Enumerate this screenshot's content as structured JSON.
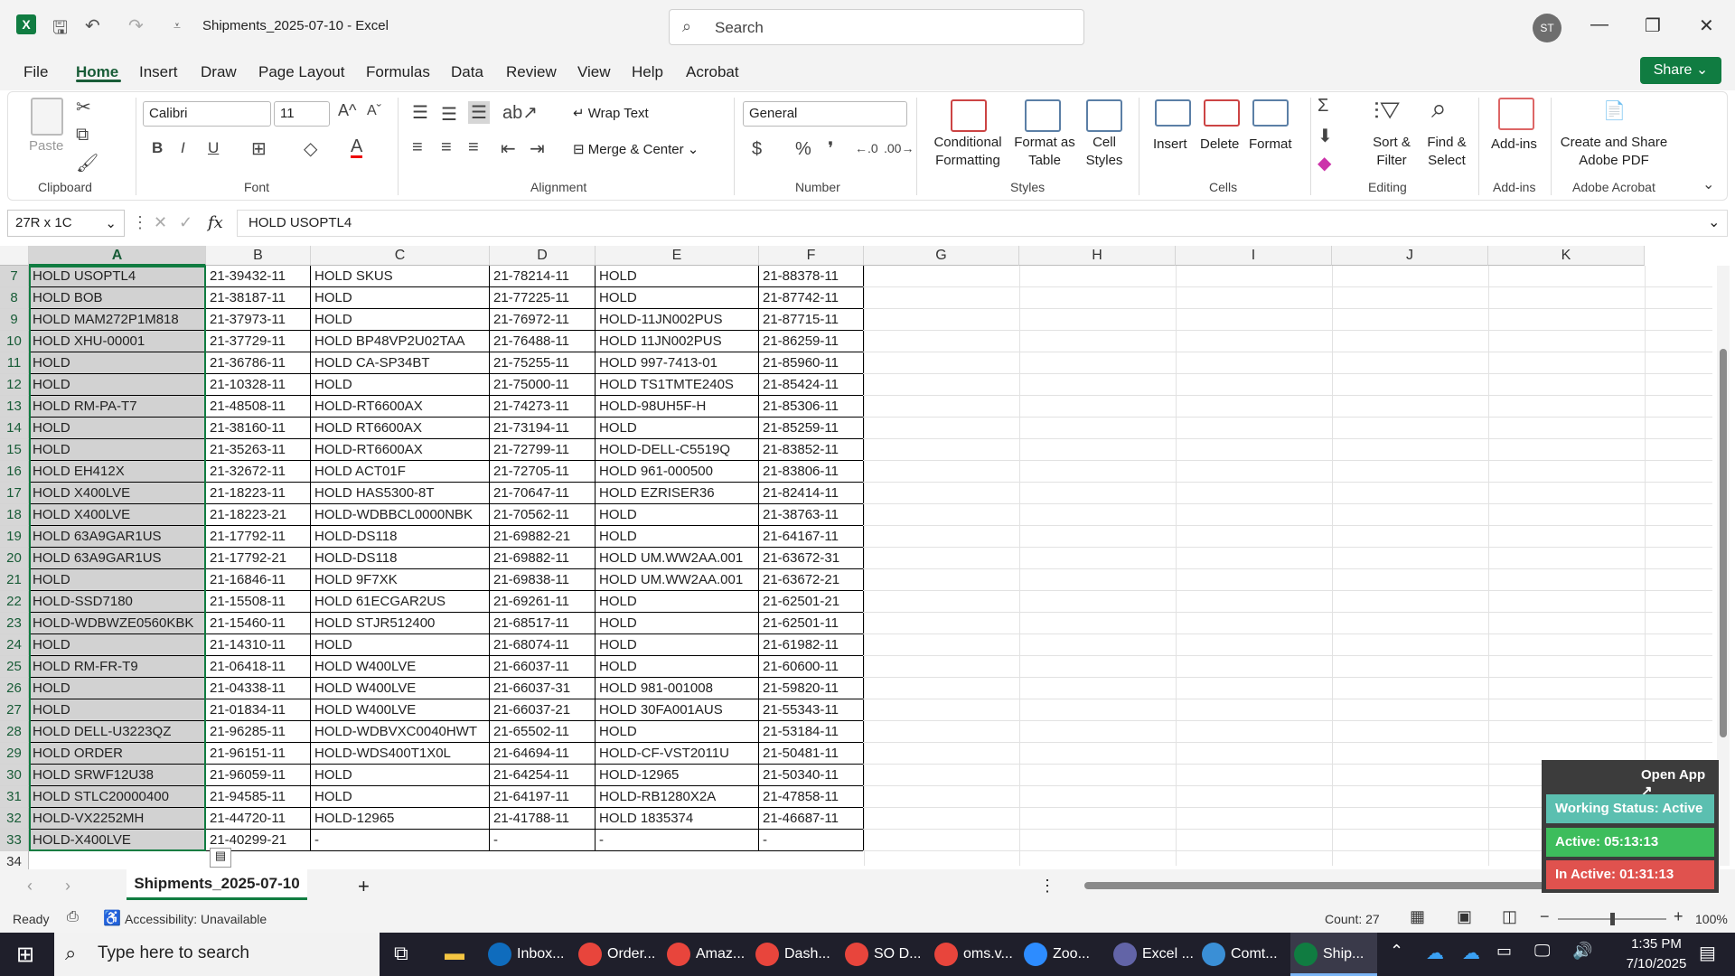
{
  "window": {
    "title": "Shipments_2025-07-10 - Excel",
    "search_placeholder": "Search",
    "user_initials": "ST"
  },
  "tabs": [
    "File",
    "Home",
    "Insert",
    "Draw",
    "Page Layout",
    "Formulas",
    "Data",
    "Review",
    "View",
    "Help",
    "Acrobat"
  ],
  "share_label": "Share",
  "ribbon": {
    "clipboard": {
      "paste": "Paste",
      "label": "Clipboard"
    },
    "font": {
      "name": "Calibri",
      "size": "11",
      "label": "Font"
    },
    "alignment": {
      "wrap": "Wrap Text",
      "merge": "Merge & Center",
      "label": "Alignment"
    },
    "number": {
      "format": "General",
      "label": "Number"
    },
    "styles": {
      "conditional": "Conditional Formatting",
      "format_table": "Format as Table",
      "cell_styles": "Cell Styles",
      "label": "Styles"
    },
    "cells": {
      "insert": "Insert",
      "delete": "Delete",
      "format": "Format",
      "label": "Cells"
    },
    "editing": {
      "sort": "Sort & Filter",
      "find": "Find & Select",
      "label": "Editing"
    },
    "addins": {
      "button": "Add-ins",
      "label": "Add-ins"
    },
    "acrobat": {
      "button": "Create and Share Adobe PDF",
      "label": "Adobe Acrobat"
    }
  },
  "formula_bar": {
    "name_box": "27R x 1C",
    "fx": "fx",
    "content": "HOLD USOPTL4"
  },
  "columns": [
    "A",
    "B",
    "C",
    "D",
    "E",
    "F",
    "G",
    "H",
    "I",
    "J",
    "K"
  ],
  "rows": [
    {
      "n": "7",
      "a": "HOLD USOPTL4",
      "b": "21-39432-11",
      "c": "HOLD SKUS",
      "d": "21-78214-11",
      "e": "HOLD",
      "f": "21-88378-11"
    },
    {
      "n": "8",
      "a": "HOLD BOB",
      "b": "21-38187-11",
      "c": "HOLD",
      "d": "21-77225-11",
      "e": "HOLD",
      "f": "21-87742-11"
    },
    {
      "n": "9",
      "a": "HOLD MAM272P1M818",
      "b": "21-37973-11",
      "c": "HOLD",
      "d": "21-76972-11",
      "e": "HOLD-11JN002PUS",
      "f": "21-87715-11"
    },
    {
      "n": "10",
      "a": "HOLD XHU-00001",
      "b": "21-37729-11",
      "c": "HOLD BP48VP2U02TAA",
      "d": "21-76488-11",
      "e": "HOLD 11JN002PUS",
      "f": "21-86259-11"
    },
    {
      "n": "11",
      "a": "HOLD",
      "b": "21-36786-11",
      "c": "HOLD CA-SP34BT",
      "d": "21-75255-11",
      "e": "HOLD 997-7413-01",
      "f": "21-85960-11"
    },
    {
      "n": "12",
      "a": "HOLD",
      "b": "21-10328-11",
      "c": "HOLD",
      "d": "21-75000-11",
      "e": "HOLD TS1TMTE240S",
      "f": "21-85424-11"
    },
    {
      "n": "13",
      "a": "HOLD RM-PA-T7",
      "b": "21-48508-11",
      "c": "HOLD-RT6600AX",
      "d": "21-74273-11",
      "e": "HOLD-98UH5F-H",
      "f": "21-85306-11"
    },
    {
      "n": "14",
      "a": "HOLD",
      "b": "21-38160-11",
      "c": "HOLD RT6600AX",
      "d": "21-73194-11",
      "e": "HOLD",
      "f": "21-85259-11"
    },
    {
      "n": "15",
      "a": "HOLD",
      "b": "21-35263-11",
      "c": "HOLD-RT6600AX",
      "d": "21-72799-11",
      "e": "HOLD-DELL-C5519Q",
      "f": "21-83852-11"
    },
    {
      "n": "16",
      "a": "HOLD EH412X",
      "b": "21-32672-11",
      "c": "HOLD ACT01F",
      "d": "21-72705-11",
      "e": "HOLD 961-000500",
      "f": "21-83806-11"
    },
    {
      "n": "17",
      "a": "HOLD X400LVE",
      "b": "21-18223-11",
      "c": "HOLD HAS5300-8T",
      "d": "21-70647-11",
      "e": "HOLD EZRISER36",
      "f": "21-82414-11"
    },
    {
      "n": "18",
      "a": "HOLD X400LVE",
      "b": "21-18223-21",
      "c": "HOLD-WDBBCL0000NBK",
      "d": "21-70562-11",
      "e": "HOLD",
      "f": "21-38763-11"
    },
    {
      "n": "19",
      "a": "HOLD 63A9GAR1US",
      "b": "21-17792-11",
      "c": "HOLD-DS118",
      "d": "21-69882-21",
      "e": "HOLD",
      "f": "21-64167-11"
    },
    {
      "n": "20",
      "a": "HOLD 63A9GAR1US",
      "b": "21-17792-21",
      "c": "HOLD-DS118",
      "d": "21-69882-11",
      "e": "HOLD UM.WW2AA.001",
      "f": "21-63672-31"
    },
    {
      "n": "21",
      "a": "HOLD",
      "b": "21-16846-11",
      "c": "HOLD 9F7XK",
      "d": "21-69838-11",
      "e": "HOLD UM.WW2AA.001",
      "f": "21-63672-21"
    },
    {
      "n": "22",
      "a": "HOLD-SSD7180",
      "b": "21-15508-11",
      "c": "HOLD 61ECGAR2US",
      "d": "21-69261-11",
      "e": "HOLD",
      "f": "21-62501-21"
    },
    {
      "n": "23",
      "a": "HOLD-WDBWZE0560KBK",
      "b": "21-15460-11",
      "c": "HOLD STJR512400",
      "d": "21-68517-11",
      "e": "HOLD",
      "f": "21-62501-11"
    },
    {
      "n": "24",
      "a": "HOLD",
      "b": "21-14310-11",
      "c": "HOLD",
      "d": "21-68074-11",
      "e": "HOLD",
      "f": "21-61982-11"
    },
    {
      "n": "25",
      "a": "HOLD RM-FR-T9",
      "b": "21-06418-11",
      "c": "HOLD W400LVE",
      "d": "21-66037-11",
      "e": "HOLD",
      "f": "21-60600-11"
    },
    {
      "n": "26",
      "a": "HOLD",
      "b": "21-04338-11",
      "c": "HOLD W400LVE",
      "d": "21-66037-31",
      "e": "HOLD 981-001008",
      "f": "21-59820-11"
    },
    {
      "n": "27",
      "a": "HOLD",
      "b": "21-01834-11",
      "c": "HOLD W400LVE",
      "d": "21-66037-21",
      "e": "HOLD 30FA001AUS",
      "f": "21-55343-11"
    },
    {
      "n": "28",
      "a": "HOLD DELL-U3223QZ",
      "b": "21-96285-11",
      "c": "HOLD-WDBVXC0040HWT",
      "d": "21-65502-11",
      "e": "HOLD",
      "f": "21-53184-11"
    },
    {
      "n": "29",
      "a": "HOLD ORDER",
      "b": "21-96151-11",
      "c": "HOLD-WDS400T1X0L",
      "d": "21-64694-11",
      "e": "HOLD-CF-VST2011U",
      "f": "21-50481-11"
    },
    {
      "n": "30",
      "a": "HOLD SRWF12U38",
      "b": "21-96059-11",
      "c": "HOLD",
      "d": "21-64254-11",
      "e": "HOLD-12965",
      "f": "21-50340-11"
    },
    {
      "n": "31",
      "a": "HOLD STLC20000400",
      "b": "21-94585-11",
      "c": "HOLD",
      "d": "21-64197-11",
      "e": "HOLD-RB1280X2A",
      "f": "21-47858-11"
    },
    {
      "n": "32",
      "a": "HOLD-VX2252MH",
      "b": "21-44720-11",
      "c": "HOLD-12965",
      "d": "21-41788-11",
      "e": "HOLD 1835374",
      "f": "21-46687-11"
    },
    {
      "n": "33",
      "a": "HOLD-X400LVE",
      "b": "21-40299-21",
      "c": "-",
      "d": "-",
      "e": "-",
      "f": "-"
    }
  ],
  "next_row": "34",
  "sheet_tab": "Shipments_2025-07-10",
  "status": {
    "ready": "Ready",
    "accessibility": "Accessibility: Unavailable",
    "count": "Count: 27",
    "zoom": "100%"
  },
  "widget": {
    "open_app": "Open App ↗",
    "working": "Working Status: Active",
    "active": "Active: 05:13:13",
    "inactive": "In Active: 01:31:13",
    "colors": {
      "working": "#5bbfb0",
      "active": "#3dbd5c",
      "inactive": "#e0524e"
    }
  },
  "taskbar": {
    "search": "Type here to search",
    "apps": [
      "Inbox...",
      "Order...",
      "Amaz...",
      "Dash...",
      "SO D...",
      "oms.v...",
      "Zoo...",
      "Excel ...",
      "Comt...",
      "Ship..."
    ],
    "time": "1:35 PM",
    "date": "7/10/2025"
  }
}
